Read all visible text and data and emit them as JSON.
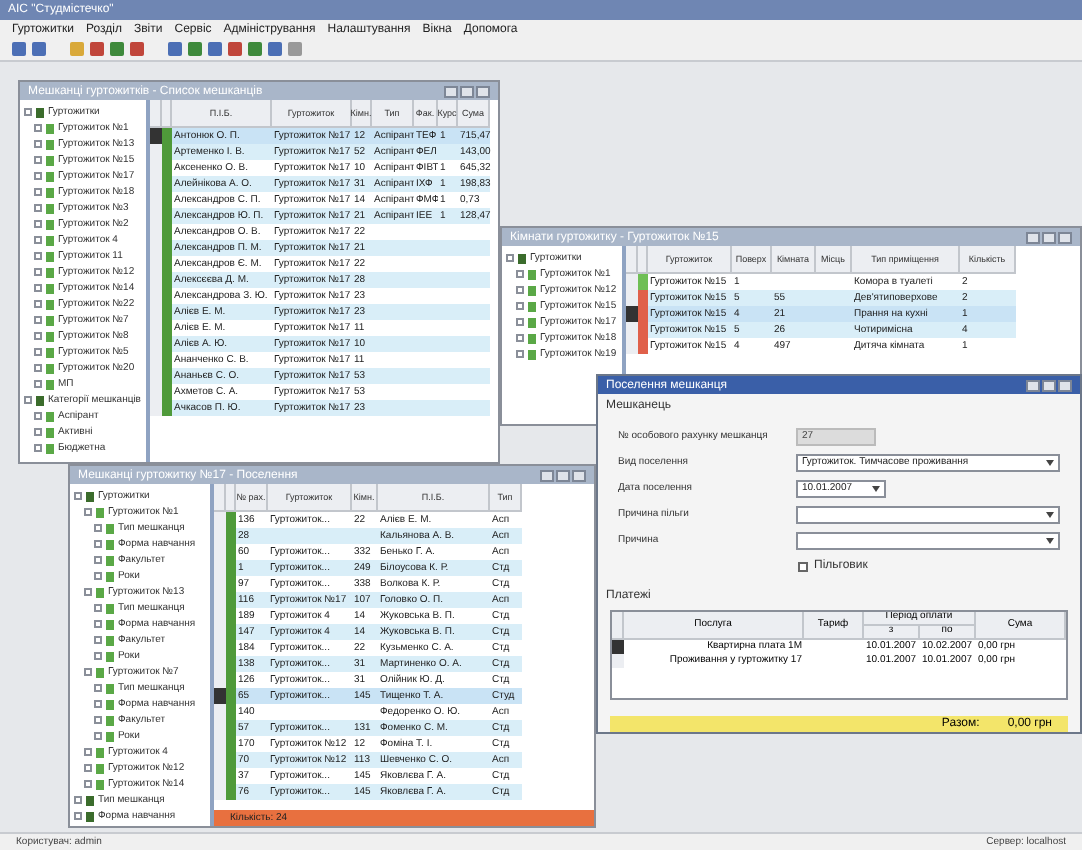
{
  "app": {
    "title": "АІС \"Студмістечко\"",
    "menu": [
      "Гуртожитки",
      "Розділ",
      "Звіти",
      "Сервіс",
      "Адміністрування",
      "Налаштування",
      "Вікна",
      "Допомога"
    ],
    "status": [
      "Користувач: admin",
      "Сервер: localhost"
    ]
  },
  "window_a": {
    "title": "Мешканці гуртожитків - Список мешканців",
    "tree": [
      {
        "label": "Гуртожитки",
        "children": [
          {
            "label": "Гуртожиток №1"
          },
          {
            "label": "Гуртожиток №13"
          },
          {
            "label": "Гуртожиток №15"
          },
          {
            "label": "Гуртожиток №17"
          },
          {
            "label": "Гуртожиток №18"
          },
          {
            "label": "Гуртожиток №3"
          },
          {
            "label": "Гуртожиток №2"
          },
          {
            "label": "Гуртожиток 4"
          },
          {
            "label": "Гуртожиток 11"
          },
          {
            "label": "Гуртожиток №12"
          },
          {
            "label": "Гуртожиток №14"
          },
          {
            "label": "Гуртожиток №22"
          },
          {
            "label": "Гуртожиток №7"
          },
          {
            "label": "Гуртожиток №8"
          },
          {
            "label": "Гуртожиток №5"
          },
          {
            "label": "Гуртожиток №20"
          },
          {
            "label": "МП"
          }
        ]
      },
      {
        "label": "Категорії мешканців",
        "children": [
          {
            "label": "Аспірант"
          },
          {
            "label": "Активні"
          },
          {
            "label": "Бюджетна"
          }
        ]
      }
    ],
    "columns": [
      "П.І.Б.",
      "Гуртожиток",
      "Кімн.",
      "Тип",
      "Фак.",
      "Курс",
      "Сума"
    ],
    "rows": [
      {
        "selected": true,
        "cells": [
          "Антонюк О. П.",
          "Гуртожиток №17",
          "12",
          "Аспірант",
          "ТЕФ",
          "1",
          "715,47"
        ]
      },
      {
        "selected": false,
        "cells": [
          "Артеменко І. В.",
          "Гуртожиток №17",
          "52",
          "Аспірант",
          "ФЕЛ",
          "",
          "143,00"
        ]
      },
      {
        "selected": false,
        "cells": [
          "Аксененко О. В.",
          "Гуртожиток №17",
          "10",
          "Аспірант",
          "ФІВТ",
          "1",
          "645,32"
        ]
      },
      {
        "selected": false,
        "cells": [
          "Алейнікова А. О.",
          "Гуртожиток №17",
          "31",
          "Аспірант",
          "ІХФ",
          "1",
          "198,83"
        ]
      },
      {
        "selected": false,
        "cells": [
          "Александров С. П.",
          "Гуртожиток №17",
          "14",
          "Аспірант",
          "ФМФ",
          "1",
          "0,73"
        ]
      },
      {
        "selected": false,
        "cells": [
          "Александров Ю. П.",
          "Гуртожиток №17",
          "21",
          "Аспірант",
          "ІЕЕ",
          "1",
          "128,47"
        ]
      },
      {
        "selected": false,
        "cells": [
          "Александров О. В.",
          "Гуртожиток №17",
          "22",
          "",
          "",
          "",
          ""
        ]
      },
      {
        "selected": false,
        "cells": [
          "Александров П. М.",
          "Гуртожиток №17",
          "21",
          "",
          "",
          "",
          ""
        ]
      },
      {
        "selected": false,
        "cells": [
          "Александров Є. М.",
          "Гуртожиток №17",
          "22",
          "",
          "",
          "",
          ""
        ]
      },
      {
        "selected": false,
        "cells": [
          "Алексєєва Д. М.",
          "Гуртожиток №17",
          "28",
          "",
          "",
          "",
          ""
        ]
      },
      {
        "selected": false,
        "cells": [
          "Александрова З. Ю.",
          "Гуртожиток №17",
          "23",
          "",
          "",
          "",
          ""
        ]
      },
      {
        "selected": false,
        "cells": [
          "Алієв Е. М.",
          "Гуртожиток №17",
          "23",
          "",
          "",
          "",
          ""
        ]
      },
      {
        "selected": false,
        "cells": [
          "Алієв Е. М.",
          "Гуртожиток №17",
          "11",
          "",
          "",
          "",
          ""
        ]
      },
      {
        "selected": false,
        "cells": [
          "Алієв А. Ю.",
          "Гуртожиток №17",
          "10",
          "",
          "",
          "",
          ""
        ]
      },
      {
        "selected": false,
        "cells": [
          "Ананченко С. В.",
          "Гуртожиток №17",
          "11",
          "",
          "",
          "",
          ""
        ]
      },
      {
        "selected": false,
        "cells": [
          "Ананьєв С. О.",
          "Гуртожиток №17",
          "53",
          "",
          "",
          "",
          ""
        ]
      },
      {
        "selected": false,
        "cells": [
          "Ахметов С. А.",
          "Гуртожиток №17",
          "53",
          "",
          "",
          "",
          ""
        ]
      },
      {
        "selected": false,
        "cells": [
          "Ачкасов П. Ю.",
          "Гуртожиток №17",
          "23",
          "",
          "",
          "",
          ""
        ]
      }
    ]
  },
  "window_b": {
    "title": "Кімнати гуртожитку - Гуртожиток №15",
    "tree": [
      {
        "label": "Гуртожитки",
        "children": [
          {
            "label": "Гуртожиток №1"
          },
          {
            "label": "Гуртожиток №12"
          },
          {
            "label": "Гуртожиток №15"
          },
          {
            "label": "Гуртожиток №17"
          },
          {
            "label": "Гуртожиток №18"
          },
          {
            "label": "Гуртожиток №19"
          }
        ]
      }
    ],
    "columns": [
      "Гуртожиток",
      "Поверх",
      "Кімната",
      "Місць",
      "Тип приміщення",
      "Кількість"
    ],
    "rows": [
      {
        "color": "#6fbf55",
        "selected": false,
        "cells": [
          "Гуртожиток №15",
          "1",
          "",
          "",
          "Комора в туалеті",
          "2"
        ]
      },
      {
        "color": "#e0604a",
        "selected": false,
        "cells": [
          "Гуртожиток №15",
          "5",
          "55",
          "",
          "Дев'ятиповерхове",
          "2"
        ]
      },
      {
        "color": "#e0604a",
        "selected": true,
        "cells": [
          "Гуртожиток №15",
          "4",
          "21",
          "",
          "Прання на кухні",
          "1"
        ]
      },
      {
        "color": "#e0604a",
        "selected": false,
        "cells": [
          "Гуртожиток №15",
          "5",
          "26",
          "",
          "Чотиримісна",
          "4"
        ]
      },
      {
        "color": "#e0604a",
        "selected": false,
        "cells": [
          "Гуртожиток №15",
          "4",
          "497",
          "",
          "Дитяча кімната",
          "1"
        ]
      }
    ]
  },
  "window_c": {
    "title": "Мешканці гуртожитку №17 - Поселення",
    "tree": [
      {
        "label": "Гуртожитки",
        "children": [
          {
            "label": "Гуртожиток №1",
            "children": [
              {
                "label": "Тип мешканця"
              },
              {
                "label": "Форма навчання"
              },
              {
                "label": "Факультет"
              },
              {
                "label": "Роки"
              }
            ]
          },
          {
            "label": "Гуртожиток №13",
            "children": [
              {
                "label": "Тип мешканця"
              },
              {
                "label": "Форма навчання"
              },
              {
                "label": "Факультет"
              },
              {
                "label": "Роки"
              }
            ]
          },
          {
            "label": "Гуртожиток №7",
            "children": [
              {
                "label": "Тип мешканця"
              },
              {
                "label": "Форма навчання"
              },
              {
                "label": "Факультет"
              },
              {
                "label": "Роки"
              }
            ]
          },
          {
            "label": "Гуртожиток 4"
          },
          {
            "label": "Гуртожиток №12"
          },
          {
            "label": "Гуртожиток №14"
          }
        ]
      },
      {
        "label": "Тип мешканця"
      },
      {
        "label": "Форма навчання"
      }
    ],
    "columns": [
      "№ рах.",
      "Гуртожиток",
      "Кімн.",
      "П.І.Б.",
      "Тип"
    ],
    "rows": [
      {
        "selected": false,
        "cells": [
          "136",
          "Гуртожиток...",
          "22",
          "Алієв Е. М.",
          "Асп"
        ]
      },
      {
        "selected": false,
        "cells": [
          "28",
          "",
          "",
          "Кальянова А. В.",
          "Асп"
        ]
      },
      {
        "selected": false,
        "cells": [
          "60",
          "Гуртожиток...",
          "332",
          "Бенько Г. А.",
          "Асп"
        ]
      },
      {
        "selected": false,
        "cells": [
          "1",
          "Гуртожиток...",
          "249",
          "Білоусова К. Р.",
          "Стд"
        ]
      },
      {
        "selected": false,
        "cells": [
          "97",
          "Гуртожиток...",
          "338",
          "Волкова К. Р.",
          "Стд"
        ]
      },
      {
        "selected": false,
        "cells": [
          "116",
          "Гуртожиток №17",
          "107",
          "Головко О. П.",
          "Асп"
        ]
      },
      {
        "selected": false,
        "cells": [
          "189",
          "Гуртожиток 4",
          "14",
          "Жуковська В. П.",
          "Стд"
        ]
      },
      {
        "selected": false,
        "cells": [
          "147",
          "Гуртожиток 4",
          "14",
          "Жуковська В. П.",
          "Стд"
        ]
      },
      {
        "selected": false,
        "cells": [
          "184",
          "Гуртожиток...",
          "22",
          "Кузьменко С. А.",
          "Стд"
        ]
      },
      {
        "selected": false,
        "cells": [
          "138",
          "Гуртожиток...",
          "31",
          "Мартиненко О. А.",
          "Стд"
        ]
      },
      {
        "selected": false,
        "cells": [
          "126",
          "Гуртожиток...",
          "31",
          "Олійник Ю. Д.",
          "Стд"
        ]
      },
      {
        "selected": true,
        "cells": [
          "65",
          "Гуртожиток...",
          "145",
          "Тищенко Т. А.",
          "Студ"
        ]
      },
      {
        "selected": false,
        "cells": [
          "140",
          "",
          "",
          "Федоренко О. Ю.",
          "Асп"
        ]
      },
      {
        "selected": false,
        "cells": [
          "57",
          "Гуртожиток...",
          "131",
          "Фоменко С. М.",
          "Стд"
        ]
      },
      {
        "selected": false,
        "cells": [
          "170",
          "Гуртожиток №12",
          "12",
          "Фоміна Т. І.",
          "Стд"
        ]
      },
      {
        "selected": false,
        "cells": [
          "70",
          "Гуртожиток №12",
          "113",
          "Шевченко С. О.",
          "Асп"
        ]
      },
      {
        "selected": false,
        "cells": [
          "37",
          "Гуртожиток...",
          "145",
          "Яковлєва Г. А.",
          "Стд"
        ]
      },
      {
        "selected": false,
        "cells": [
          "76",
          "Гуртожиток...",
          "145",
          "Яковлєва Г. А.",
          "Стд"
        ]
      }
    ],
    "footer": "Кількість: 24"
  },
  "dialog": {
    "title": "Поселення мешканця",
    "section": "Мешканець",
    "fields": [
      {
        "kind": "text",
        "label": "№ особового рахунку мешканця",
        "value": "27",
        "disabled": true
      },
      {
        "kind": "select",
        "label": "Вид поселення",
        "value": "Гуртожиток. Тимчасове проживання",
        "disabled": false
      },
      {
        "kind": "date",
        "label": "Дата поселення",
        "value": "10.01.2007",
        "disabled": false
      },
      {
        "kind": "select",
        "label": "Причина пільги",
        "disabled": false
      },
      {
        "kind": "select",
        "label": "Причина",
        "disabled": false
      },
      {
        "kind": "checkbox",
        "label": "Пільговик",
        "checked": false
      }
    ],
    "payments_title": "Платежі",
    "columns": [
      "Послуга",
      "Тариф",
      "Період оплати",
      "Сума"
    ],
    "period_columns": [
      "з",
      "по"
    ],
    "rows": [
      {
        "selected": true,
        "cells": [
          "Квартирна плата 1М",
          "",
          "10.01.2007",
          "10.02.2007",
          "0,00 грн"
        ]
      },
      {
        "selected": false,
        "cells": [
          "Проживання у гуртожитку 17",
          "",
          "10.01.2007",
          "10.01.2007",
          "0,00 грн"
        ]
      }
    ],
    "total_label": "Разом:",
    "total": "0,00 грн"
  }
}
